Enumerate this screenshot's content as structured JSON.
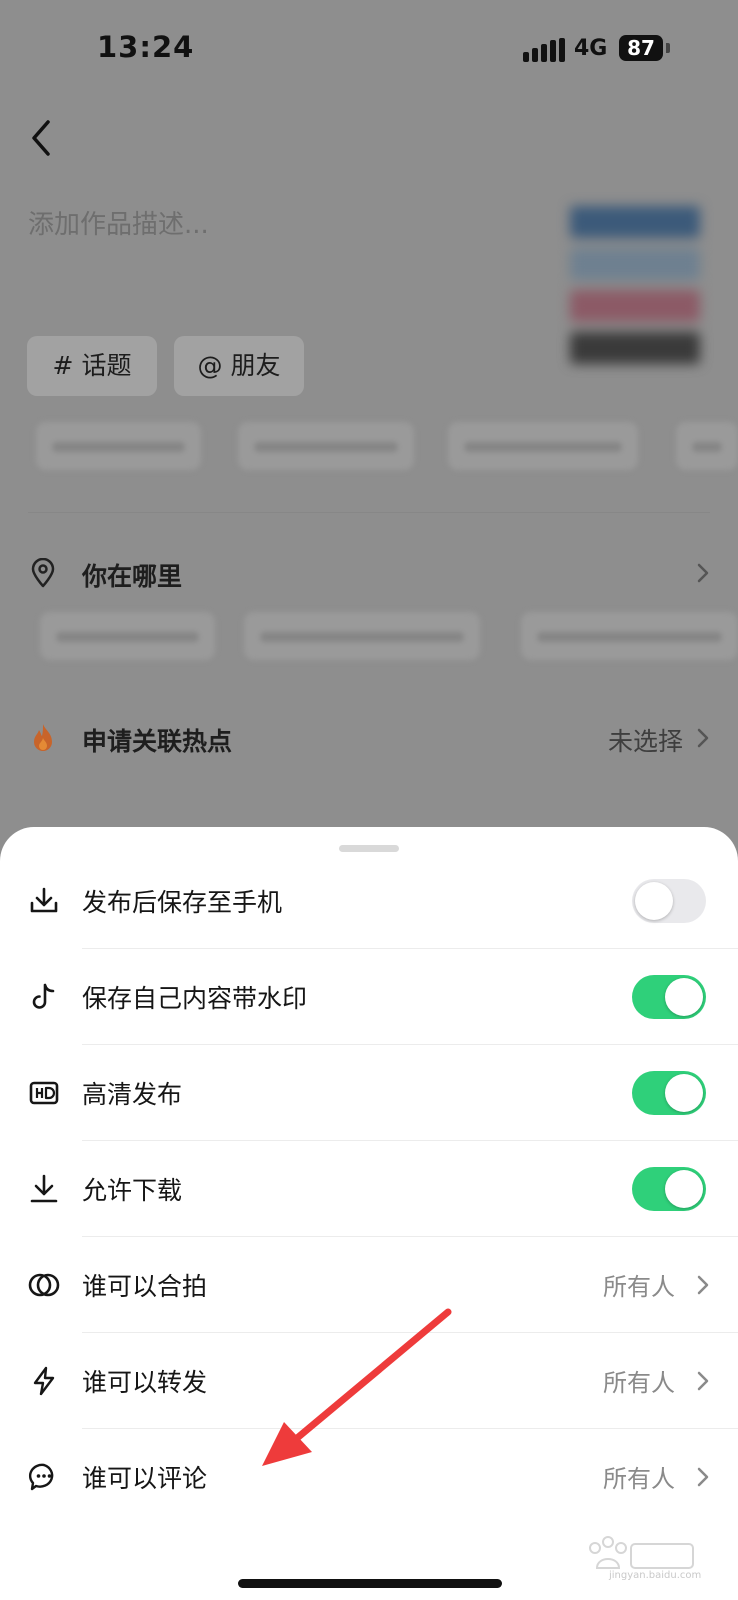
{
  "status_bar": {
    "time": "13:24",
    "network": "4G",
    "battery": "87"
  },
  "editor": {
    "description_placeholder": "添加作品描述...",
    "tags": [
      {
        "label": "# 话题"
      },
      {
        "label": "@ 朋友"
      }
    ],
    "location_label": "你在哪里",
    "hotspot_label": "申请关联热点",
    "hotspot_value": "未选择"
  },
  "sheet": {
    "rows": [
      {
        "label": "发布后保存至手机",
        "icon": "download-icon",
        "toggle": false
      },
      {
        "label": "保存自己内容带水印",
        "icon": "tiktok-note-icon",
        "toggle": true
      },
      {
        "label": "高清发布",
        "icon": "hd-icon",
        "toggle": true
      },
      {
        "label": "允许下载",
        "icon": "download-icon",
        "toggle": true
      },
      {
        "label": "谁可以合拍",
        "icon": "duet-icon",
        "value": "所有人"
      },
      {
        "label": "谁可以转发",
        "icon": "lightning-icon",
        "value": "所有人"
      },
      {
        "label": "谁可以评论",
        "icon": "comment-icon",
        "value": "所有人"
      }
    ]
  },
  "watermark": {
    "text": "jingyan.baidu.com"
  },
  "colors": {
    "toggle_on": "#2fd07a",
    "toggle_off": "#e9e9ec",
    "annotation_arrow": "#ee3b3b"
  }
}
